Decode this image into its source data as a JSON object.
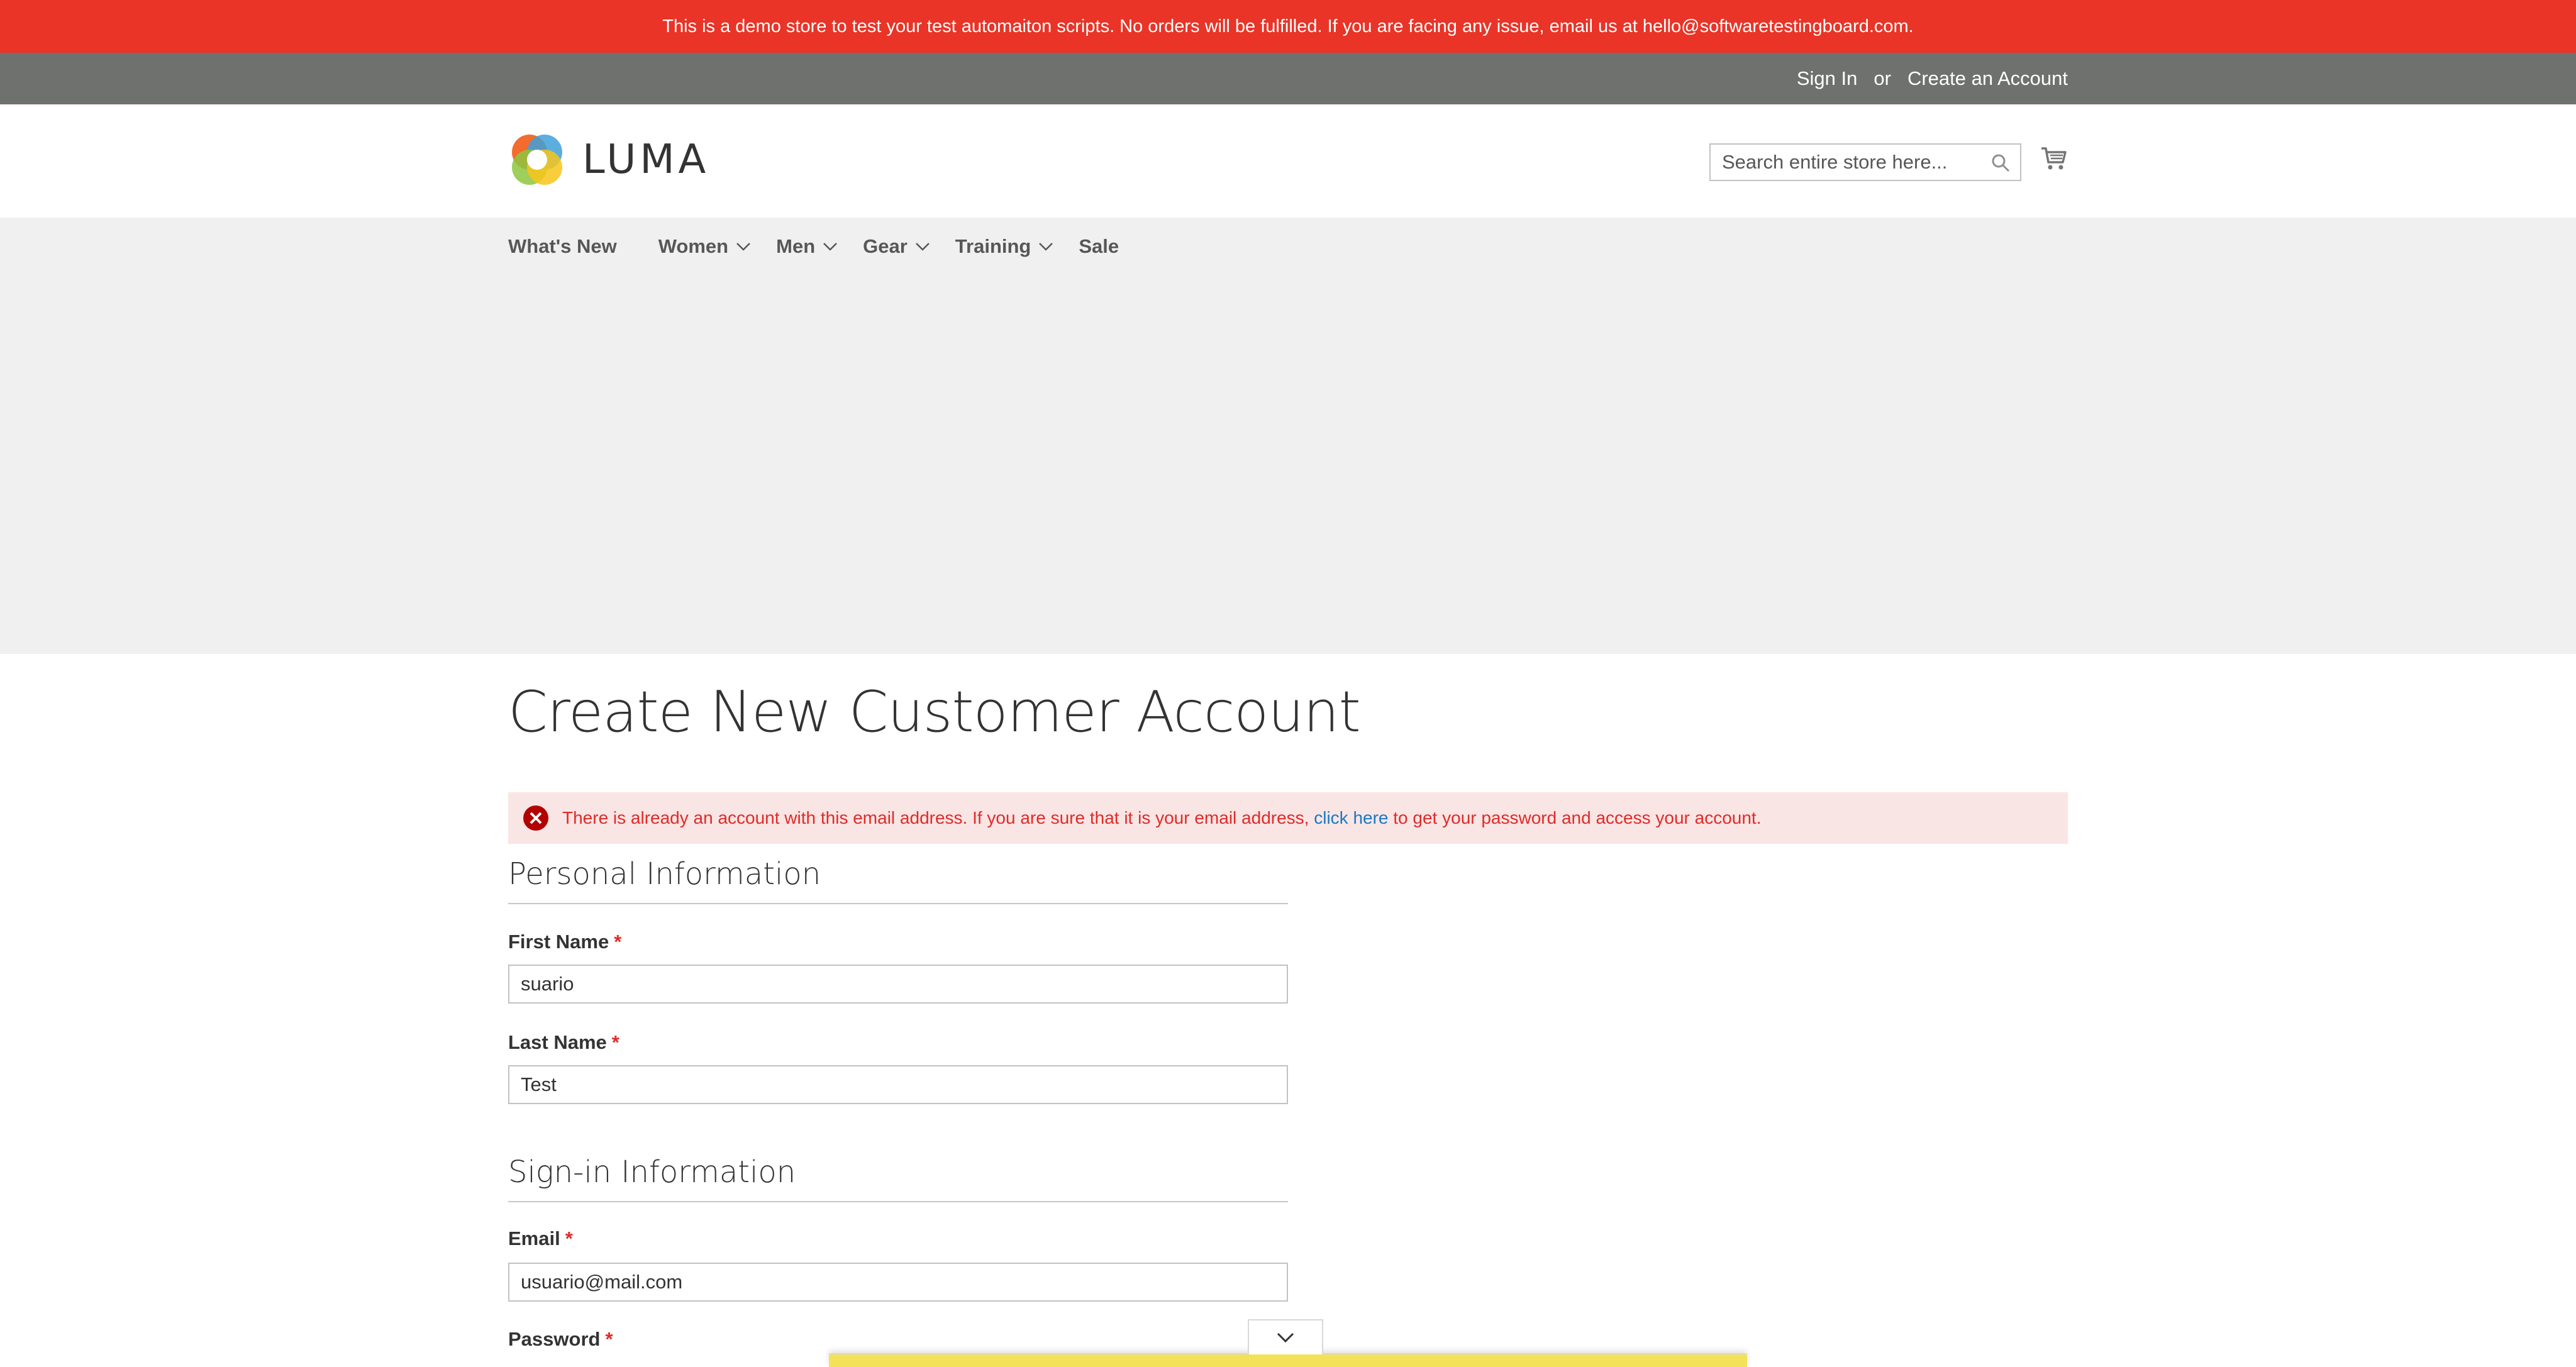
{
  "banner": {
    "text": "This is a demo store to test your test automaiton scripts. No orders will be fulfilled. If you are facing any issue, email us at hello@softwaretestingboard.com."
  },
  "top_links": {
    "sign_in": "Sign In",
    "or": "or",
    "create_account": "Create an Account"
  },
  "header": {
    "logo_text": "LUMA",
    "search_placeholder": "Search entire store here..."
  },
  "nav": {
    "items": [
      {
        "label": "What's New"
      },
      {
        "label": "Women"
      },
      {
        "label": "Men"
      },
      {
        "label": "Gear"
      },
      {
        "label": "Training"
      },
      {
        "label": "Sale"
      }
    ]
  },
  "page": {
    "title": "Create New Customer Account"
  },
  "error": {
    "text_before": "There is already an account with this email address. If you are sure that it is your email address,",
    "link": "click here",
    "text_after": "to get your password and access your account."
  },
  "personal_info": {
    "title": "Personal Information",
    "first_name_label": "First Name",
    "first_name_value": "suario",
    "last_name_label": "Last Name",
    "last_name_value": "Test",
    "required_mark": "*"
  },
  "signin_info": {
    "title": "Sign-in Information",
    "email_label": "Email",
    "email_value": "usuario@mail.com",
    "password_label": "Password",
    "required_mark": "*"
  },
  "colors": {
    "banner": "#e93427",
    "top_bar": "#6e716e",
    "nav_bg": "#f0f0f0",
    "error_bg": "#fae5e5",
    "error_text": "#e02b27",
    "link": "#1979c3"
  },
  "icons": {
    "search": "search-icon",
    "cart": "cart-icon",
    "chevron": "chevron-down-icon",
    "error": "error-circle-icon",
    "logo": "luma-logo-icon"
  }
}
